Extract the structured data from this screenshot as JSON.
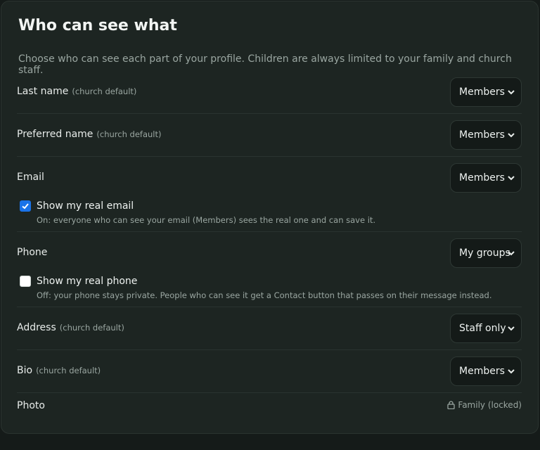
{
  "title": "Who can see what",
  "description": "Choose who can see each part of your profile. Children are always limited to your family and church staff.",
  "fields": {
    "last_name": {
      "label": "Last name",
      "hint": "(church default)",
      "value": "Members"
    },
    "preferred_name": {
      "label": "Preferred name",
      "hint": "(church default)",
      "value": "Members"
    },
    "email": {
      "label": "Email",
      "value": "Members"
    },
    "phone": {
      "label": "Phone",
      "value": "My groups"
    },
    "address": {
      "label": "Address",
      "hint": "(church default)",
      "value": "Staff only"
    },
    "bio": {
      "label": "Bio",
      "hint": "(church default)",
      "value": "Members"
    },
    "photo": {
      "label": "Photo",
      "locked_text": "Family (locked)"
    }
  },
  "email_option": {
    "label": "Show my real email",
    "checked": true,
    "note": "On: everyone who can see your email (Members) sees the real one and can save it."
  },
  "phone_option": {
    "label": "Show my real phone",
    "checked": false,
    "note": "Off: your phone stays private. People who can see it get a Contact button that passes on their message instead."
  },
  "colors": {
    "background": "#151b19",
    "panel": "#1d2522",
    "accent": "#1a73e8"
  },
  "icons": [
    "chevron-down-icon",
    "checkmark-icon",
    "lock-icon"
  ]
}
